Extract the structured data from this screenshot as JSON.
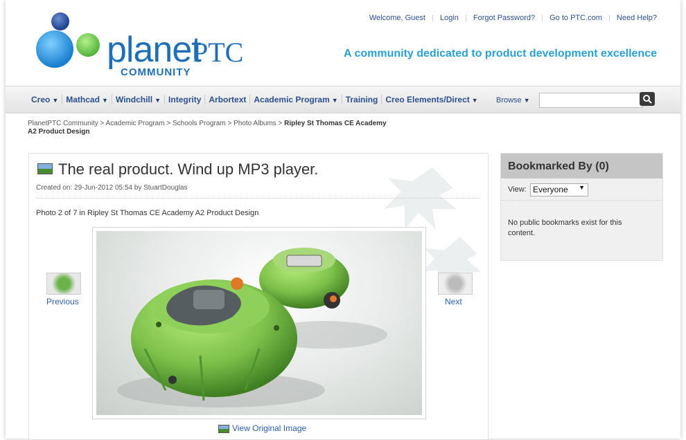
{
  "header": {
    "logo_main": "planet",
    "logo_ptc": "PTC",
    "logo_sub": "COMMUNITY",
    "top_links": [
      "Welcome, Guest",
      "Login",
      "Forgot Password?",
      "Go to PTC.com",
      "Need Help?"
    ],
    "tagline": "A community dedicated to product development excellence"
  },
  "nav": {
    "items": [
      {
        "label": "Creo",
        "dropdown": true
      },
      {
        "label": "Mathcad",
        "dropdown": true
      },
      {
        "label": "Windchill",
        "dropdown": true
      },
      {
        "label": "Integrity",
        "dropdown": false
      },
      {
        "label": "Arbortext",
        "dropdown": false
      },
      {
        "label": "Academic Program",
        "dropdown": true
      },
      {
        "label": "Training",
        "dropdown": false
      },
      {
        "label": "Creo Elements/Direct",
        "dropdown": true
      }
    ],
    "browse_label": "Browse",
    "search_placeholder": ""
  },
  "breadcrumb": {
    "path": "PlanetPTC Community > Academic Program > Schools Program > Photo Albums >",
    "current": "Ripley St Thomas CE Academy A2 Product Design"
  },
  "content": {
    "title": "The real product. Wind up MP3 player.",
    "created": "Created on: 29-Jun-2012 05:54 by StuartDouglas",
    "photo_of": "Photo 2 of 7 in Ripley St Thomas CE Academy A2 Product Design",
    "previous_label": "Previous",
    "next_label": "Next",
    "view_original_label": "View Original Image"
  },
  "sidebar": {
    "title": "Bookmarked By (0)",
    "view_label": "View:",
    "view_selected": "Everyone",
    "message": "No public bookmarks exist for this content."
  },
  "colors": {
    "link_blue": "#2b4f8c",
    "tagline_blue": "#2a9fd6",
    "logo_blue": "#1f6fb8",
    "product_green": "#7cc04a"
  }
}
